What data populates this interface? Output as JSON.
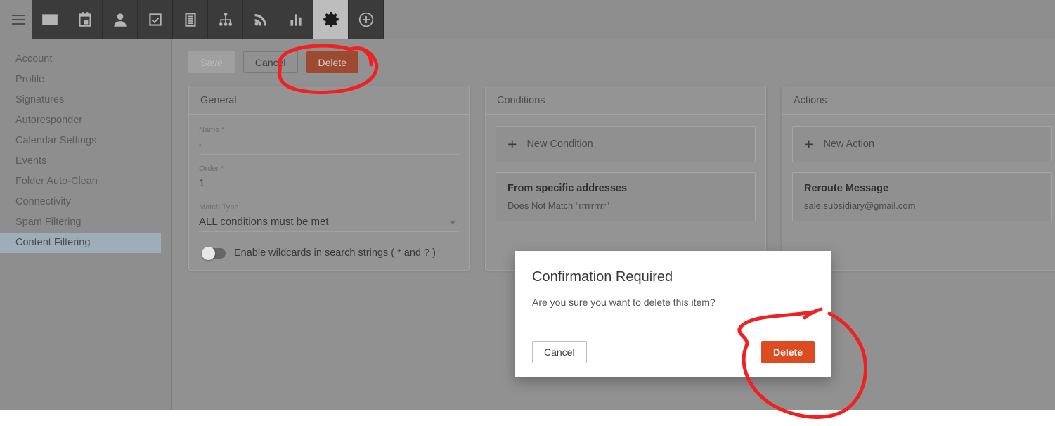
{
  "topbar": {
    "menu_icon": "hamburger-menu-icon",
    "icons": [
      {
        "name": "mail-icon",
        "active": false
      },
      {
        "name": "calendar-icon",
        "active": false
      },
      {
        "name": "contacts-icon",
        "active": false
      },
      {
        "name": "tasks-icon",
        "active": false
      },
      {
        "name": "notes-icon",
        "active": false
      },
      {
        "name": "sitemap-icon",
        "active": false
      },
      {
        "name": "rss-feed-icon",
        "active": false
      },
      {
        "name": "reports-chart-icon",
        "active": false
      },
      {
        "name": "settings-gear-icon",
        "active": true
      },
      {
        "name": "add-plus-circle-icon",
        "active": false
      }
    ]
  },
  "sidebar": {
    "items": [
      {
        "label": "Account",
        "selected": false
      },
      {
        "label": "Profile",
        "selected": false
      },
      {
        "label": "Signatures",
        "selected": false
      },
      {
        "label": "Autoresponder",
        "selected": false
      },
      {
        "label": "Calendar Settings",
        "selected": false
      },
      {
        "label": "Events",
        "selected": false
      },
      {
        "label": "Folder Auto-Clean",
        "selected": false
      },
      {
        "label": "Connectivity",
        "selected": false
      },
      {
        "label": "Spam Filtering",
        "selected": false
      },
      {
        "label": "Content Filtering",
        "selected": true
      }
    ]
  },
  "toolbar": {
    "save_label": "Save",
    "cancel_label": "Cancel",
    "delete_label": "Delete"
  },
  "general_panel": {
    "title": "General",
    "name_label": "Name *",
    "name_value": "-",
    "order_label": "Order *",
    "order_value": "1",
    "match_type_label": "Match Type",
    "match_type_value": "ALL conditions must be met",
    "wildcards_label": "Enable wildcards in search strings ( * and ? )",
    "wildcards_enabled": false
  },
  "conditions_panel": {
    "title": "Conditions",
    "new_label": "New Condition",
    "items": [
      {
        "title": "From specific addresses",
        "subtitle": "Does Not Match \"rrrrrrrrr\""
      }
    ]
  },
  "actions_panel": {
    "title": "Actions",
    "new_label": "New Action",
    "items": [
      {
        "title": "Reroute Message",
        "subtitle": "sale.subsidiary@gmail.com"
      }
    ]
  },
  "dialog": {
    "title": "Confirmation Required",
    "message": "Are you sure you want to delete this item?",
    "cancel_label": "Cancel",
    "delete_label": "Delete"
  },
  "colors": {
    "accent_delete": "#dd4b20",
    "delete_dimmed": "#9e4a32",
    "sidebar_selected": "#9eaeb8",
    "annotation_red": "#ee2222",
    "topbar_dark": "#3b3b3b",
    "overlay_gray": "#8e8e8e"
  }
}
